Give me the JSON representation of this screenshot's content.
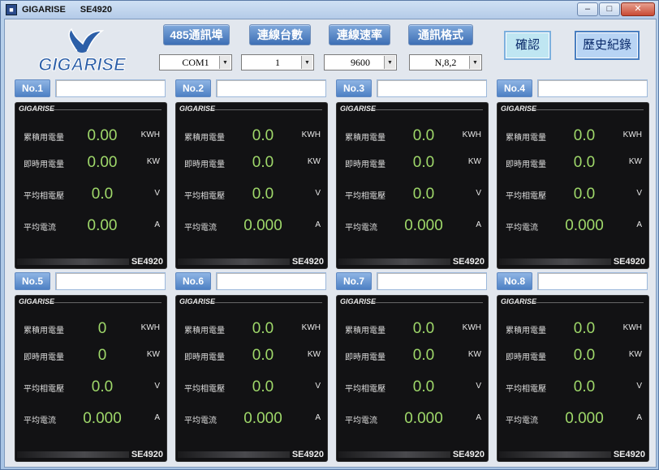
{
  "window": {
    "brand": "GIGARISE",
    "model": "SE4920",
    "controls": {
      "minimize": "–",
      "maximize": "□",
      "close": "✕"
    }
  },
  "logo": {
    "text": "GIGARISE",
    "colors": {
      "bird": "#2c5fa8",
      "text": "#2c5fa8",
      "outline": "#ffffff"
    }
  },
  "toolbar": {
    "buttons": [
      {
        "label": "485通訊埠",
        "value": "COM1"
      },
      {
        "label": "連線台數",
        "value": "1"
      },
      {
        "label": "連線速率",
        "value": "9600"
      },
      {
        "label": "通訊格式",
        "value": "N,8,2"
      }
    ],
    "confirm": "確認",
    "history": "歷史紀錄"
  },
  "meter_labels": {
    "energy": "累積用電量",
    "power": "即時用電量",
    "voltage": "平均相電壓",
    "current": "平均電流"
  },
  "units": {
    "energy": "KWH",
    "power": "KW",
    "voltage": "V",
    "current": "A"
  },
  "meter_brand": "GIGARISE",
  "panels": [
    {
      "no": "No.1",
      "model": "SE4920",
      "energy": "0.00",
      "power": "0.00",
      "voltage": "0.0",
      "current": "0.00"
    },
    {
      "no": "No.2",
      "model": "SE4920",
      "energy": "0.0",
      "power": "0.0",
      "voltage": "0.0",
      "current": "0.000"
    },
    {
      "no": "No.3",
      "model": "SE4920",
      "energy": "0.0",
      "power": "0.0",
      "voltage": "0.0",
      "current": "0.000"
    },
    {
      "no": "No.4",
      "model": "SE4920",
      "energy": "0.0",
      "power": "0.0",
      "voltage": "0.0",
      "current": "0.000"
    },
    {
      "no": "No.5",
      "model": "SE4920",
      "energy": "0",
      "power": "0",
      "voltage": "0.0",
      "current": "0.000"
    },
    {
      "no": "No.6",
      "model": "SE4920",
      "energy": "0.0",
      "power": "0.0",
      "voltage": "0.0",
      "current": "0.000"
    },
    {
      "no": "No.7",
      "model": "SE4920",
      "energy": "0.0",
      "power": "0.0",
      "voltage": "0.0",
      "current": "0.000"
    },
    {
      "no": "No.8",
      "model": "SE4920",
      "energy": "0.0",
      "power": "0.0",
      "voltage": "0.0",
      "current": "0.000"
    }
  ]
}
